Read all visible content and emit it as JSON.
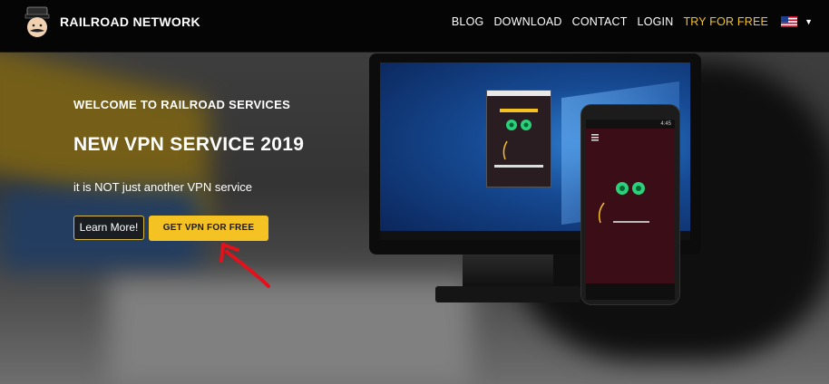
{
  "header": {
    "brand": "RAILROAD NETWORK",
    "nav": [
      {
        "label": "BLOG"
      },
      {
        "label": "DOWNLOAD"
      },
      {
        "label": "CONTACT"
      },
      {
        "label": "LOGIN"
      },
      {
        "label": "TRY FOR FREE"
      }
    ],
    "language_flag": "us-flag-icon",
    "accent_color": "#f5c224"
  },
  "hero": {
    "welcome": "WELCOME TO RAILROAD SERVICES",
    "title": "NEW VPN SERVICE 2019",
    "subtitle": "it is NOT just another VPN service",
    "learn_more_label": "Learn More!",
    "get_vpn_label": "GET VPN FOR FREE"
  },
  "devices": {
    "phone_time": "4:45"
  }
}
